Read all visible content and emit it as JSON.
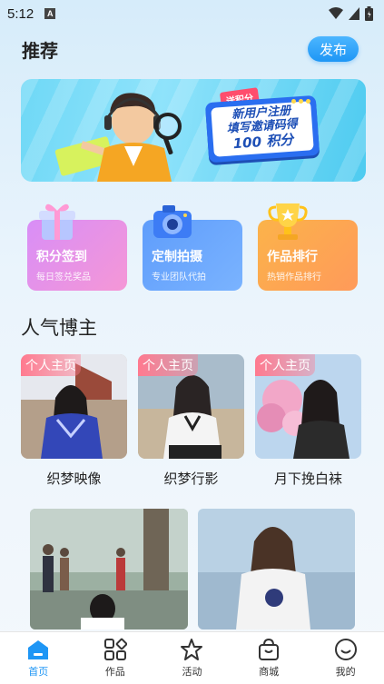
{
  "status_bar": {
    "time": "5:12",
    "notif_letter": "A"
  },
  "header": {
    "title": "推荐",
    "publish_label": "发布"
  },
  "banner": {
    "tag": "送积分",
    "line1": "新用户注册",
    "line2": "填写邀请码得",
    "line3": "100 积分"
  },
  "features": [
    {
      "title": "积分签到",
      "subtitle": "每日签兑奖品",
      "icon": "gift-box-icon"
    },
    {
      "title": "定制拍摄",
      "subtitle": "专业团队代拍",
      "icon": "camera-icon"
    },
    {
      "title": "作品排行",
      "subtitle": "热销作品排行",
      "icon": "trophy-icon"
    }
  ],
  "section": {
    "title": "人气博主"
  },
  "bloggers": [
    {
      "badge": "个人主页",
      "name": "织梦映像"
    },
    {
      "badge": "个人主页",
      "name": "织梦行影"
    },
    {
      "badge": "个人主页",
      "name": "月下挽白袜"
    }
  ],
  "tabbar": {
    "items": [
      {
        "label": "首页",
        "icon": "home-icon",
        "active": true
      },
      {
        "label": "作品",
        "icon": "grid-icon",
        "active": false
      },
      {
        "label": "活动",
        "icon": "star-icon",
        "active": false
      },
      {
        "label": "商城",
        "icon": "shopping-bag-icon",
        "active": false
      },
      {
        "label": "我的",
        "icon": "smiley-user-icon",
        "active": false
      }
    ]
  },
  "colors": {
    "accent": "#1e96f5"
  }
}
